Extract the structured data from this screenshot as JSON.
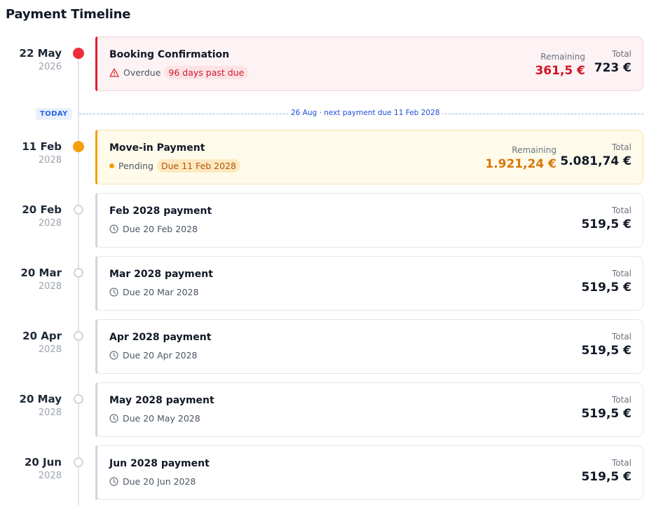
{
  "page": {
    "title": "Payment Timeline"
  },
  "today": {
    "badge": "TODAY",
    "note": "26 Aug · next payment due 11 Feb 2028"
  },
  "colors": {
    "overdue": "#e11d2e",
    "pending": "#f59e0b",
    "today": "#2563eb",
    "neutral": "#d1d5db"
  },
  "payments": [
    {
      "day": "22 May",
      "year": "2026",
      "status": "overdue",
      "title": "Booking Confirmation",
      "status_label": "Overdue",
      "badge": "96 days past due",
      "icon": "warning-icon",
      "remaining_label": "Remaining",
      "remaining": "361,5 €",
      "total_label": "Total",
      "total": "723 €"
    },
    {
      "day": "11 Feb",
      "year": "2028",
      "status": "pending",
      "title": "Move-in Payment",
      "status_label": "Pending",
      "badge": "Due 11 Feb 2028",
      "icon": "pending-dot-icon",
      "remaining_label": "Remaining",
      "remaining": "1.921,24 €",
      "total_label": "Total",
      "total": "5.081,74 €"
    },
    {
      "day": "20 Feb",
      "year": "2028",
      "status": "upcoming",
      "title": "Feb 2028 payment",
      "due": "Due 20 Feb 2028",
      "icon": "clock-icon",
      "total_label": "Total",
      "total": "519,5 €"
    },
    {
      "day": "20 Mar",
      "year": "2028",
      "status": "upcoming",
      "title": "Mar 2028 payment",
      "due": "Due 20 Mar 2028",
      "icon": "clock-icon",
      "total_label": "Total",
      "total": "519,5 €"
    },
    {
      "day": "20 Apr",
      "year": "2028",
      "status": "upcoming",
      "title": "Apr 2028 payment",
      "due": "Due 20 Apr 2028",
      "icon": "clock-icon",
      "total_label": "Total",
      "total": "519,5 €"
    },
    {
      "day": "20 May",
      "year": "2028",
      "status": "upcoming",
      "title": "May 2028 payment",
      "due": "Due 20 May 2028",
      "icon": "clock-icon",
      "total_label": "Total",
      "total": "519,5 €"
    },
    {
      "day": "20 Jun",
      "year": "2028",
      "status": "upcoming",
      "title": "Jun 2028 payment",
      "due": "Due 20 Jun 2028",
      "icon": "clock-icon",
      "total_label": "Total",
      "total": "519,5 €"
    }
  ]
}
